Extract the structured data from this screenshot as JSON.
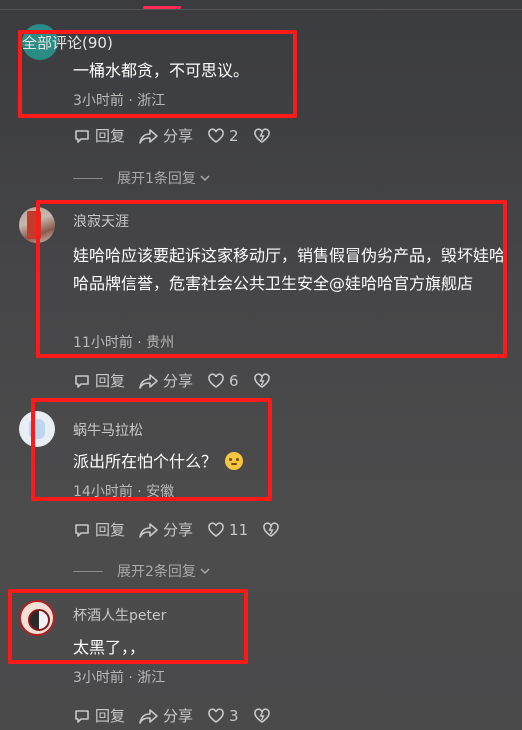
{
  "header": {
    "title": "全部评论(90)"
  },
  "comments": [
    {
      "username": "",
      "content": "一桶水都贪，不可思议。",
      "meta": "3小时前 · 浙江",
      "reply_label": "回复",
      "share_label": "分享",
      "likes": "2",
      "expand": "展开1条回复"
    },
    {
      "username": "浪寂天涯",
      "content": "娃哈哈应该要起诉这家移动厅，销售假冒伪劣产品，毁坏娃哈哈品牌信誉，危害社会公共卫生安全@娃哈哈官方旗舰店",
      "meta": "11小时前 · 贵州",
      "reply_label": "回复",
      "share_label": "分享",
      "likes": "6"
    },
    {
      "username": "蜗牛马拉松",
      "content": "派出所在怕个什么？",
      "meta": "14小时前 · 安徽",
      "reply_label": "回复",
      "share_label": "分享",
      "likes": "11",
      "expand": "展开2条回复"
    },
    {
      "username": "杯酒人生peter",
      "content": "太黑了，，",
      "meta": "3小时前 · 浙江",
      "reply_label": "回复",
      "share_label": "分享",
      "likes": "3"
    }
  ],
  "colors": {
    "highlight_box": "#ff1a1a",
    "tab_indicator": "#fe2c55"
  },
  "icons": [
    "reply-icon",
    "share-icon",
    "heart-icon",
    "dislike-heart-icon",
    "chevron-down-icon"
  ]
}
